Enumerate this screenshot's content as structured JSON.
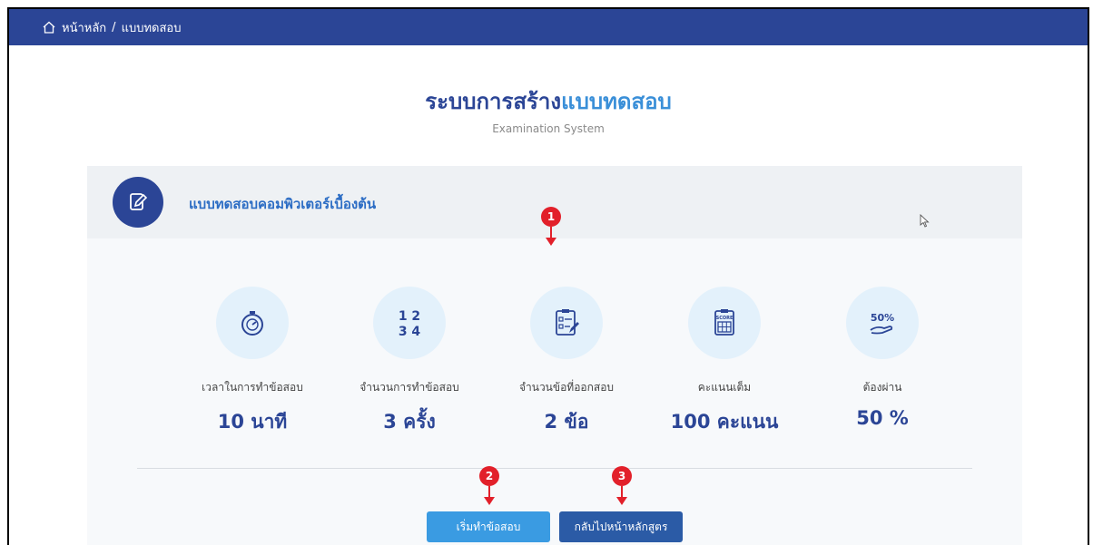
{
  "breadcrumb": {
    "home": "หน้าหลัก",
    "separator": "/",
    "current": "แบบทดสอบ"
  },
  "heading": {
    "title_part1": "ระบบการสร้าง",
    "title_part2": "แบบทดสอบ",
    "subtitle": "Examination System"
  },
  "exam": {
    "title": "แบบทดสอบคอมพิวเตอร์เบื้องต้น"
  },
  "stats": [
    {
      "icon": "stopwatch-icon",
      "label": "เวลาในการทำข้อสอบ",
      "value": "10 นาที"
    },
    {
      "icon": "numbers-icon",
      "label": "จำนวนการทำข้อสอบ",
      "value": "3 ครั้ง"
    },
    {
      "icon": "checklist-icon",
      "label": "จำนวนข้อที่ออกสอบ",
      "value": "2 ข้อ"
    },
    {
      "icon": "score-board-icon",
      "label": "คะแนนเต็ม",
      "value": "100 คะแนน"
    },
    {
      "icon": "percent-hand-icon",
      "label": "ต้องผ่าน",
      "value": "50 %"
    }
  ],
  "buttons": {
    "start": "เริ่มทำข้อสอบ",
    "back": "กลับไปหน้าหลักสูตร"
  },
  "markers": [
    "1",
    "2",
    "3"
  ],
  "icon_text": {
    "numbers_top": "1 2",
    "numbers_bottom": "3 4",
    "score": "SCORE",
    "percent": "50%"
  },
  "colors": {
    "primary": "#2b4596",
    "accent": "#3a8fd8",
    "marker": "#e2202a",
    "start_button": "#3a9be2",
    "back_button": "#2b5ba6"
  }
}
